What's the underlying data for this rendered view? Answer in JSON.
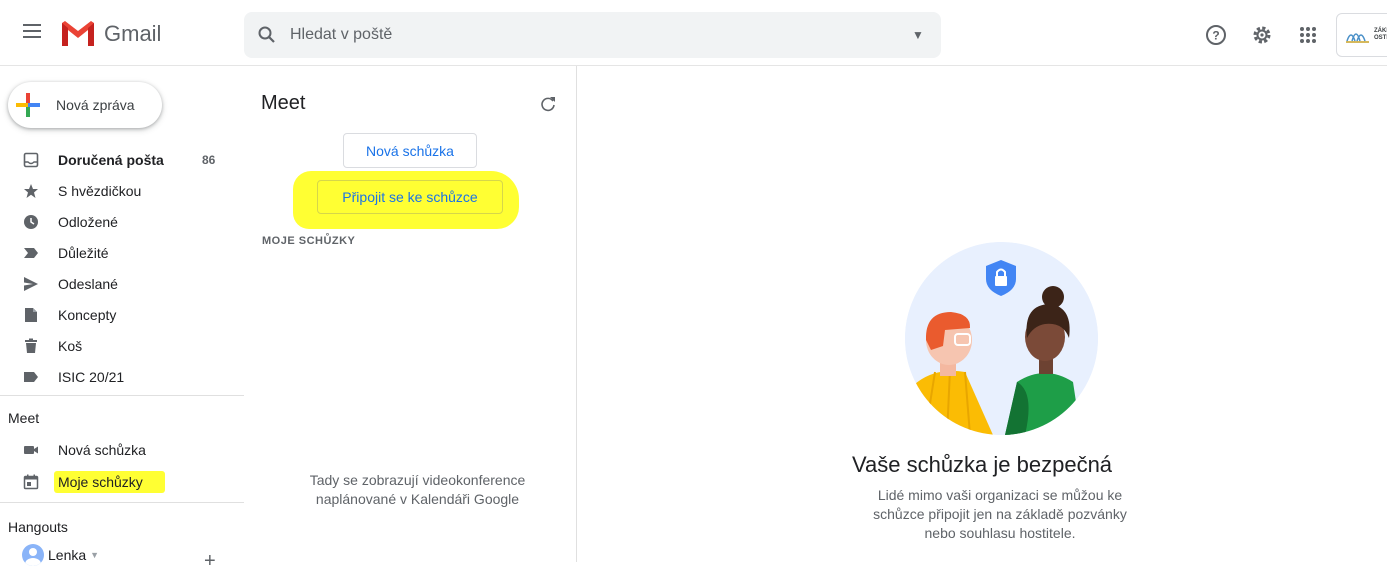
{
  "header": {
    "app_name": "Gmail",
    "search_placeholder": "Hledat v poště"
  },
  "sidebar": {
    "compose_label": "Nová zpráva",
    "items": [
      {
        "label": "Doručená pošta",
        "count": "86",
        "icon": "inbox-icon"
      },
      {
        "label": "S hvězdičkou",
        "icon": "star-icon"
      },
      {
        "label": "Odložené",
        "icon": "clock-icon"
      },
      {
        "label": "Důležité",
        "icon": "important-icon"
      },
      {
        "label": "Odeslané",
        "icon": "send-icon"
      },
      {
        "label": "Koncepty",
        "icon": "draft-icon"
      },
      {
        "label": "Koš",
        "icon": "trash-icon"
      },
      {
        "label": "ISIC 20/21",
        "icon": "label-icon"
      }
    ],
    "meet": {
      "title": "Meet",
      "new_meeting": "Nová schůzka",
      "my_meetings": "Moje schůzky"
    },
    "hangouts": {
      "title": "Hangouts",
      "user": "Lenka"
    }
  },
  "meet_pane": {
    "title": "Meet",
    "new_meeting_button": "Nová schůzka",
    "join_button": "Připojit se ke schůzce",
    "section_label": "MOJE SCHŮZKY",
    "empty_line1": "Tady se zobrazují videokonference",
    "empty_line2": "naplánované v Kalendáři Google"
  },
  "info_panel": {
    "heading": "Vaše schůzka je bezpečná",
    "desc_line1": "Lidé mimo vaši organizaci se můžou ke",
    "desc_line2": "schůzce připojit jen na základě pozvánky",
    "desc_line3": "nebo souhlasu hostitele."
  },
  "colors": {
    "highlight": "#ffff33",
    "link_blue": "#1a73e8",
    "gmail_red": "#ea4335"
  }
}
